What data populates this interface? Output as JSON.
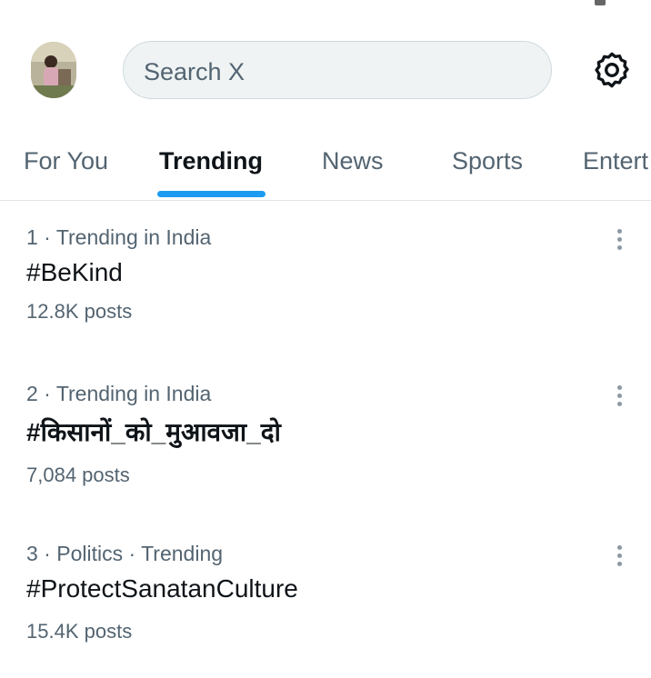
{
  "search": {
    "placeholder": "Search X"
  },
  "tabs": [
    {
      "label": "For You"
    },
    {
      "label": "Trending"
    },
    {
      "label": "News"
    },
    {
      "label": "Sports"
    },
    {
      "label": "Entert"
    }
  ],
  "active_tab": "Trending",
  "trends": [
    {
      "meta": "1 · Trending in India",
      "title": "#BeKind",
      "posts": "12.8K posts"
    },
    {
      "meta": "2 · Trending in India",
      "title": "#किसानों_को_मुआवजा_दो",
      "posts": "7,084 posts"
    },
    {
      "meta": "3 · Politics · Trending",
      "title": "#ProtectSanatanCulture",
      "posts": "15.4K posts"
    }
  ],
  "icons": {
    "settings": "gear-icon",
    "more": "more-vertical-icon",
    "avatar": "avatar"
  },
  "colors": {
    "accent": "#1d9bf0",
    "text": "#0f1419",
    "secondary": "#536471",
    "search_bg": "#eff3f4"
  }
}
